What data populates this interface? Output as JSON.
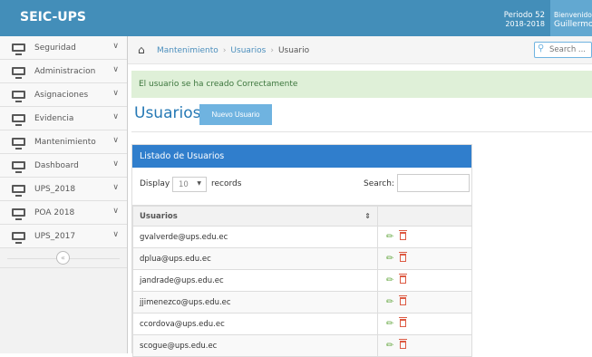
{
  "navbar": {
    "brand": "SEIC-UPS",
    "periodo_label": "Periodo 52",
    "periodo_years": "2018-2018",
    "welcome_label": "Bienvenido,",
    "welcome_user": "Guillermo"
  },
  "sidebar": {
    "items": [
      {
        "label": "Seguridad"
      },
      {
        "label": "Administracion"
      },
      {
        "label": "Asignaciones"
      },
      {
        "label": "Evidencia"
      },
      {
        "label": "Mantenimiento"
      },
      {
        "label": "Dashboard"
      },
      {
        "label": "UPS_2018"
      },
      {
        "label": "POA 2018"
      },
      {
        "label": "UPS_2017"
      }
    ],
    "collapse_icon": "«"
  },
  "breadcrumb": {
    "home_icon": "home-icon",
    "items": [
      "Mantenimiento",
      "Usuarios"
    ],
    "current": "Usuario",
    "separator": "›"
  },
  "search": {
    "placeholder": "Search ..."
  },
  "alert": {
    "message": "El usuario se ha creado Correctamente"
  },
  "page": {
    "title": "Usuarios",
    "new_button": "Nuevo Usuario"
  },
  "table": {
    "heading": "Listado de Usuarios",
    "display_label": "Display",
    "page_size": "10",
    "records_label": "records",
    "search_label": "Search:",
    "column": "Usuarios",
    "rows": [
      "gvalverde@ups.edu.ec",
      "dplua@ups.edu.ec",
      "jandrade@ups.edu.ec",
      "jjimenezco@ups.edu.ec",
      "ccordova@ups.edu.ec",
      "scogue@ups.edu.ec"
    ]
  },
  "colors": {
    "navbar": "#438eb9",
    "accent": "#307ecc",
    "edit": "#69aa46",
    "delete": "#dd5a43",
    "alert_bg": "#dff0d8"
  }
}
